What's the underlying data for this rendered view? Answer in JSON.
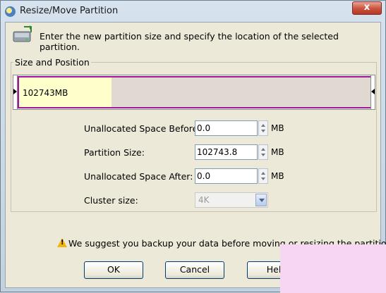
{
  "window": {
    "title": "Resize/Move Partition",
    "close_label": "x"
  },
  "hint": {
    "text": "Enter the new partition size and specify the location of the selected partition.",
    "icon": "disk-resize-icon"
  },
  "size_position": {
    "group_title": "Size and Position",
    "partition_label": "102743MB",
    "used_fraction": 0.26,
    "colors": {
      "border": "#a0169b",
      "used": "#ffffcc",
      "free": "#dfd9d1"
    }
  },
  "fields": {
    "before": {
      "label": "Unallocated Space Before:",
      "value": "0.0",
      "unit": "MB"
    },
    "size": {
      "label": "Partition Size:",
      "value": "102743.8",
      "unit": "MB"
    },
    "after": {
      "label": "Unallocated Space After:",
      "value": "0.0",
      "unit": "MB"
    },
    "cluster": {
      "label": "Cluster size:",
      "value": "4K"
    }
  },
  "warning": {
    "text": "We suggest you backup your data before moving or resizing the partition."
  },
  "buttons": {
    "ok": "OK",
    "cancel": "Cancel",
    "help": "Help"
  }
}
